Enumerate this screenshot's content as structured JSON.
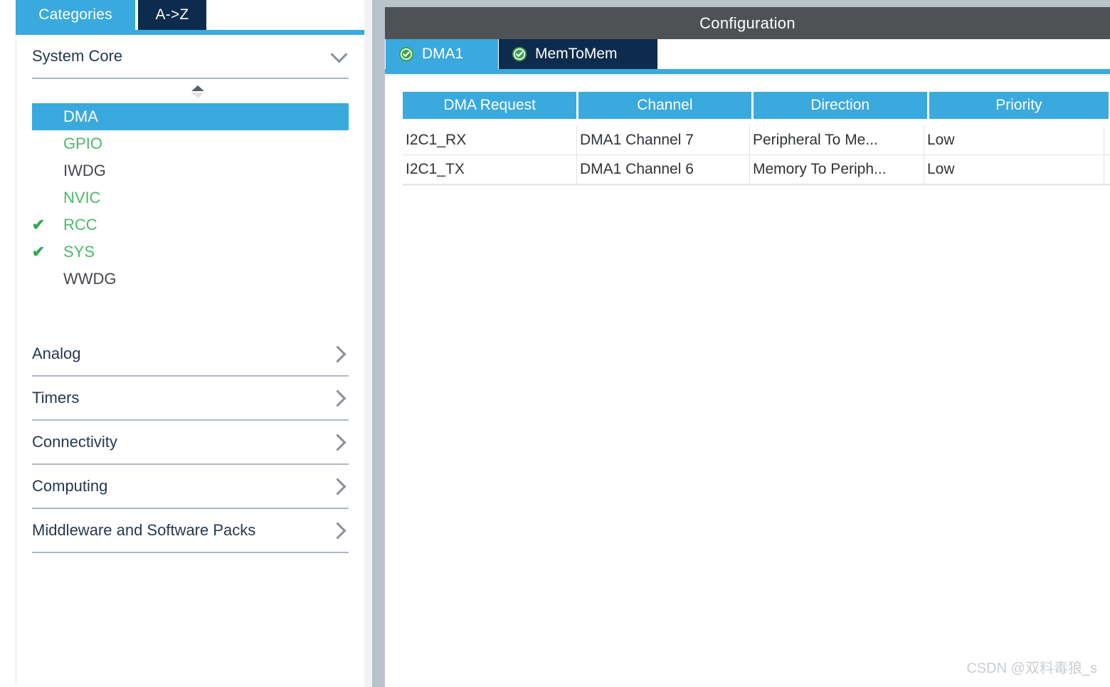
{
  "left_panel": {
    "tabs": [
      {
        "label": "Categories",
        "active": true
      },
      {
        "label": "A->Z",
        "active": false
      }
    ],
    "system_core": {
      "label": "System Core",
      "expanded": true,
      "chevron_icon": "chevron-down-icon",
      "sort_icon": "sort-toggle-icon",
      "peripherals": [
        {
          "label": "DMA",
          "state": "selected",
          "check": ""
        },
        {
          "label": "GPIO",
          "state": "green",
          "check": ""
        },
        {
          "label": "IWDG",
          "state": "gray",
          "check": ""
        },
        {
          "label": "NVIC",
          "state": "green",
          "check": ""
        },
        {
          "label": "RCC",
          "state": "green",
          "check": "✔"
        },
        {
          "label": "SYS",
          "state": "green",
          "check": "✔"
        },
        {
          "label": "WWDG",
          "state": "gray",
          "check": ""
        }
      ]
    },
    "groups": [
      {
        "label": "Analog",
        "chevron_icon": "chevron-right-icon"
      },
      {
        "label": "Timers",
        "chevron_icon": "chevron-right-icon"
      },
      {
        "label": "Connectivity",
        "chevron_icon": "chevron-right-icon"
      },
      {
        "label": "Computing",
        "chevron_icon": "chevron-right-icon"
      },
      {
        "label": "Middleware and Software Packs",
        "chevron_icon": "chevron-right-icon"
      }
    ]
  },
  "right_panel": {
    "title": "Configuration",
    "tabs": [
      {
        "label": "DMA1",
        "active": true,
        "status_icon": "check-circle-icon"
      },
      {
        "label": "MemToMem",
        "active": false,
        "status_icon": "check-circle-icon"
      }
    ],
    "table": {
      "columns": [
        "DMA Request",
        "Channel",
        "Direction",
        "Priority"
      ],
      "rows": [
        [
          "I2C1_RX",
          "DMA1 Channel 7",
          "Peripheral To Me...",
          "Low"
        ],
        [
          "I2C1_TX",
          "DMA1 Channel 6",
          "Memory To Periph...",
          "Low"
        ]
      ]
    }
  },
  "watermark": "CSDN @双料毒狼_s",
  "colors": {
    "accent_blue": "#3aa9dd",
    "dark_navy": "#0d2b4d",
    "title_bar_gray": "#4e5254",
    "splitter_gray": "#b7c3cb",
    "green_text": "#4cb96b",
    "gray_text": "#44474b",
    "group_label": "#26374f"
  }
}
